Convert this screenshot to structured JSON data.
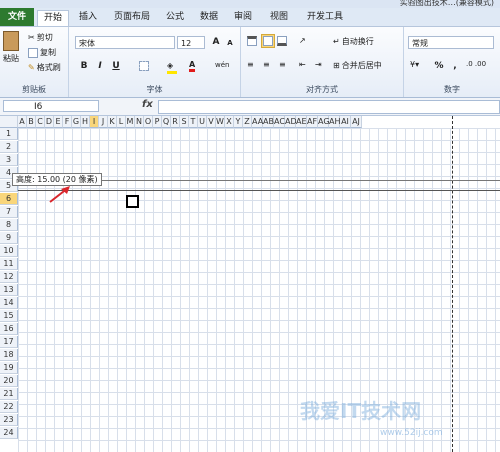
{
  "window": {
    "title": "实验图出技术…(兼容模式)"
  },
  "tabs": [
    "文件",
    "开始",
    "插入",
    "页面布局",
    "公式",
    "数据",
    "审阅",
    "视图",
    "开发工具"
  ],
  "clipboard": {
    "paste": "粘贴",
    "cut": "剪切",
    "copy": "复制",
    "format_painter": "格式刷",
    "label": "剪贴板"
  },
  "font": {
    "name": "宋体",
    "size": "12",
    "bold": "B",
    "italic": "I",
    "underline": "U",
    "label": "字体",
    "grow": "A",
    "shrink": "A",
    "wen": "wén"
  },
  "alignment": {
    "wrap_text": "自动换行",
    "merge_center": "合并后居中",
    "label": "对齐方式"
  },
  "number": {
    "format": "常规",
    "percent": "%",
    "comma": ",",
    "label": "数字"
  },
  "formula_bar": {
    "name_box": "I6",
    "fx": "fx",
    "content": ""
  },
  "columns": [
    "A",
    "B",
    "C",
    "D",
    "E",
    "F",
    "G",
    "H",
    "I",
    "J",
    "K",
    "L",
    "M",
    "N",
    "O",
    "P",
    "Q",
    "R",
    "S",
    "T",
    "U",
    "V",
    "W",
    "X",
    "Y",
    "Z",
    "AA",
    "AB",
    "AC",
    "AD",
    "AE",
    "AF",
    "AG",
    "AH",
    "AI",
    "AJ"
  ],
  "rows": [
    "1",
    "2",
    "3",
    "4",
    "5",
    "6",
    "7",
    "8",
    "9",
    "10",
    "11",
    "12",
    "13",
    "14",
    "15",
    "16",
    "17",
    "18",
    "19",
    "20",
    "21",
    "22",
    "23",
    "24"
  ],
  "selected_column": "I",
  "selected_row": "6",
  "tooltip": "高度: 15.00 (20 像素)",
  "watermark": {
    "text": "我爱IT技术网",
    "url": "www.52ij.com"
  },
  "colors": {
    "file_tab": "#2d7a2f",
    "selection_header": "#f9d67b",
    "arrow": "#d9262c"
  }
}
